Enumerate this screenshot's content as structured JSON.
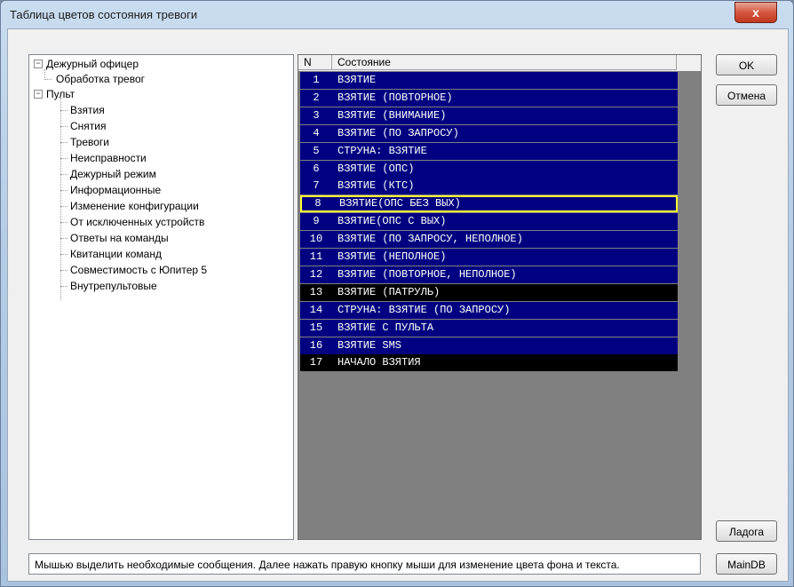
{
  "window": {
    "title": "Таблица цветов состояния тревоги",
    "close_glyph": "x"
  },
  "tree": {
    "root1": {
      "label": "Дежурный офицер",
      "expander": "−",
      "children": [
        "Обработка тревог"
      ]
    },
    "root2": {
      "label": "Пульт",
      "expander": "−",
      "children": [
        "Взятия",
        "Снятия",
        "Тревоги",
        "Неисправности",
        "Дежурный режим",
        "Информационные",
        "Изменение конфигурации",
        "От исключенных устройств",
        "Ответы на команды",
        "Квитанции команд",
        "Совместимость с Юпитер 5",
        "Внутрепультовые"
      ]
    }
  },
  "grid": {
    "headers": {
      "n": "N",
      "state": "Состояние"
    },
    "colors": {
      "blue": "#000080",
      "black": "#000000",
      "selected_border": "#ffff33"
    },
    "rows": [
      {
        "n": "1",
        "s": "ВЗЯТИЕ",
        "bg": "blue"
      },
      {
        "n": "2",
        "s": "ВЗЯТИЕ (ПОВТОРНОЕ)",
        "bg": "blue"
      },
      {
        "n": "3",
        "s": "ВЗЯТИЕ (ВНИМАНИЕ)",
        "bg": "blue"
      },
      {
        "n": "4",
        "s": "ВЗЯТИЕ (ПО ЗАПРОСУ)",
        "bg": "blue"
      },
      {
        "n": "5",
        "s": "СТРУНА: ВЗЯТИЕ",
        "bg": "blue"
      },
      {
        "n": "6",
        "s": "ВЗЯТИЕ (ОПС)",
        "bg": "blue"
      },
      {
        "n": "7",
        "s": "ВЗЯТИЕ (КТС)",
        "bg": "blue"
      },
      {
        "n": "8",
        "s": "ВЗЯТИЕ(ОПС БЕЗ ВЫХ)",
        "bg": "blue",
        "selected": true
      },
      {
        "n": "9",
        "s": "ВЗЯТИЕ(ОПС С ВЫХ)",
        "bg": "blue"
      },
      {
        "n": "10",
        "s": "ВЗЯТИЕ (ПО ЗАПРОСУ, НЕПОЛНОЕ)",
        "bg": "blue"
      },
      {
        "n": "11",
        "s": "ВЗЯТИЕ (НЕПОЛНОЕ)",
        "bg": "blue"
      },
      {
        "n": "12",
        "s": "ВЗЯТИЕ (ПОВТОРНОЕ, НЕПОЛНОЕ)",
        "bg": "blue"
      },
      {
        "n": "13",
        "s": "ВЗЯТИЕ (ПАТРУЛЬ)",
        "bg": "black"
      },
      {
        "n": "14",
        "s": "СТРУНА: ВЗЯТИЕ (ПО ЗАПРОСУ)",
        "bg": "blue"
      },
      {
        "n": "15",
        "s": "ВЗЯТИЕ С ПУЛЬТА",
        "bg": "blue"
      },
      {
        "n": "16",
        "s": "ВЗЯТИЕ SMS",
        "bg": "blue"
      },
      {
        "n": "17",
        "s": "НАЧАЛО ВЗЯТИЯ",
        "bg": "black"
      }
    ]
  },
  "buttons": {
    "ok": "OK",
    "cancel": "Отмена",
    "ladoga": "Ладога",
    "maindb": "MainDB"
  },
  "status": {
    "text": "Мышью выделить необходимые сообщения. Далее нажать правую кнопку мыши для изменение цвета фона и текста."
  }
}
